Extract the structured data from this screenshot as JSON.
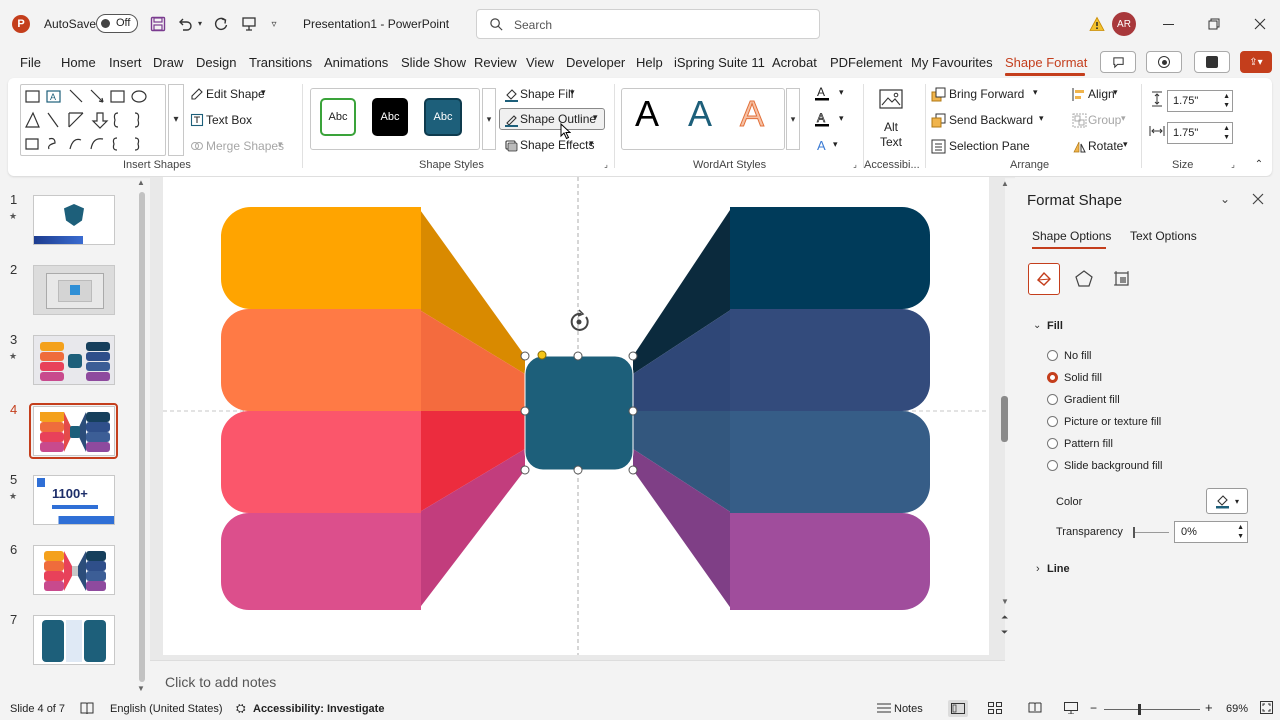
{
  "titlebar": {
    "autosave_label": "AutoSave",
    "autosave_state": "Off",
    "title": "Presentation1 - PowerPoint",
    "search_placeholder": "Search",
    "user_initials": "AR"
  },
  "menu": [
    {
      "label": "File"
    },
    {
      "label": "Home"
    },
    {
      "label": "Insert"
    },
    {
      "label": "Draw"
    },
    {
      "label": "Design"
    },
    {
      "label": "Transitions"
    },
    {
      "label": "Animations"
    },
    {
      "label": "Slide Show"
    },
    {
      "label": "Review"
    },
    {
      "label": "View"
    },
    {
      "label": "Developer"
    },
    {
      "label": "Help"
    },
    {
      "label": "iSpring Suite 11"
    },
    {
      "label": "Acrobat"
    },
    {
      "label": "PDFelement"
    },
    {
      "label": "My Favourites"
    },
    {
      "label": "Shape Format"
    }
  ],
  "ribbon": {
    "insert_shapes": {
      "edit_shape": "Edit Shape",
      "text_box": "Text Box",
      "merge_shapes": "Merge Shapes",
      "label": "Insert Shapes"
    },
    "shape_styles": {
      "style_labels": [
        "Abc",
        "Abc",
        "Abc"
      ],
      "shape_fill": "Shape Fill",
      "shape_outline": "Shape Outline",
      "shape_effects": "Shape Effects",
      "label": "Shape Styles"
    },
    "wordart": {
      "letters": [
        "A",
        "A",
        "A"
      ],
      "label": "WordArt Styles"
    },
    "accessibility": {
      "alt_text": "Alt Text",
      "label": "Accessibi..."
    },
    "arrange": {
      "bring_forward": "Bring Forward",
      "send_backward": "Send Backward",
      "selection_pane": "Selection Pane",
      "align": "Align",
      "group": "Group",
      "rotate": "Rotate",
      "label": "Arrange"
    },
    "size": {
      "height": "1.75\"",
      "width": "1.75\"",
      "label": "Size"
    }
  },
  "slides": [
    {
      "number": "1",
      "starred": true
    },
    {
      "number": "2",
      "starred": false
    },
    {
      "number": "3",
      "starred": true
    },
    {
      "number": "4",
      "starred": false,
      "selected": true
    },
    {
      "number": "5",
      "starred": true,
      "thumb_text": "1100+"
    },
    {
      "number": "6",
      "starred": false
    },
    {
      "number": "7",
      "starred": false
    }
  ],
  "notes_placeholder": "Click to add notes",
  "format_panel": {
    "title": "Format Shape",
    "tab_shape": "Shape Options",
    "tab_text": "Text Options",
    "fill_header": "Fill",
    "options": [
      "No fill",
      "Solid fill",
      "Gradient fill",
      "Picture or texture fill",
      "Pattern fill",
      "Slide background fill"
    ],
    "selected_option": "Solid fill",
    "color_label": "Color",
    "transparency_label": "Transparency",
    "transparency_value": "0%",
    "line_header": "Line"
  },
  "status": {
    "slide_info": "Slide 4 of 7",
    "language": "English (United States)",
    "accessibility": "Accessibility: Investigate",
    "notes": "Notes",
    "zoom": "69%"
  },
  "colors": {
    "accent": "#c43e1c",
    "selected_shape": "#1d5f7a"
  }
}
